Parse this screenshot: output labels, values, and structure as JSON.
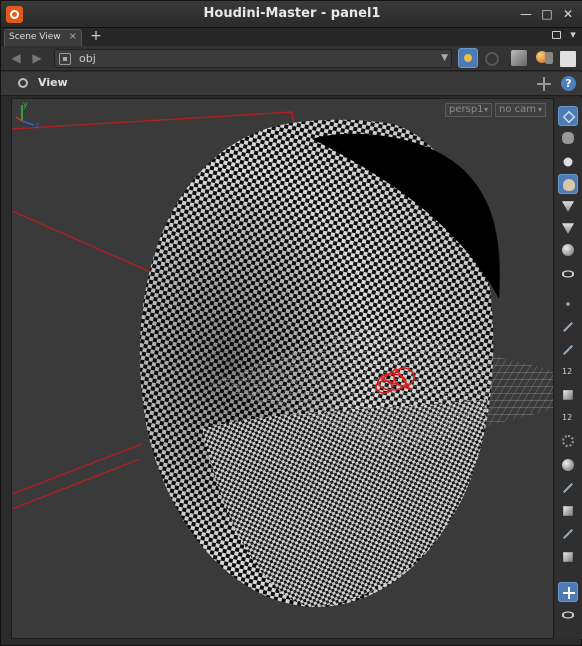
{
  "window": {
    "title": "Houdini-Master - panel1",
    "min_glyph": "—",
    "max_glyph": "□",
    "close_glyph": "✕"
  },
  "tabs": {
    "active_label": "Scene View",
    "close_glyph": "×",
    "add_glyph": "+"
  },
  "pathbar": {
    "back_glyph": "◀",
    "forward_glyph": "▶",
    "path": "obj",
    "dropdown_glyph": "▼"
  },
  "view": {
    "label": "View",
    "help_glyph": "?"
  },
  "viewport": {
    "camera": "persp1",
    "cam_select": "no cam",
    "dropdown_glyph": "▾",
    "axis_labels": {
      "x": "x",
      "y": "y",
      "z": "z"
    },
    "colors": {
      "background": "#3a3a3a",
      "guide_lines": "#b02020",
      "checker_light": "#e6e6e6",
      "checker_dark": "#111111",
      "axis_x": "#d03030",
      "axis_y": "#30c030",
      "axis_z": "#3060e0"
    }
  },
  "right_toolbar": {
    "tools": [
      {
        "name": "select-geometry-tool-icon",
        "active": true
      },
      {
        "name": "handle-tool-icon",
        "active": false
      },
      {
        "name": "sphere-display-icon",
        "active": false
      },
      {
        "name": "user-view-icon",
        "active": true
      },
      {
        "name": "light-icon",
        "active": false
      },
      {
        "name": "light-spot-icon",
        "active": false
      },
      {
        "name": "shading-ball-icon",
        "active": false
      },
      {
        "name": "visibility-eye-icon",
        "active": false
      },
      {
        "name": "point-icon",
        "active": false
      },
      {
        "name": "edge-icon",
        "active": false
      },
      {
        "name": "brush-icon",
        "active": false
      },
      {
        "name": "point-number-icon",
        "active": false
      },
      {
        "name": "primitive-icon",
        "active": false
      },
      {
        "name": "primitive-number-icon",
        "active": false
      },
      {
        "name": "dotted-icon",
        "active": false
      },
      {
        "name": "grid-ball-icon",
        "active": false
      },
      {
        "name": "snap-icon",
        "active": false
      },
      {
        "name": "template-icon",
        "active": false
      },
      {
        "name": "eyedropper-icon",
        "active": false
      },
      {
        "name": "background-image-icon",
        "active": false
      },
      {
        "name": "single-viewport-layout-icon",
        "active": true
      },
      {
        "name": "camera-capture-icon",
        "active": false
      }
    ],
    "labels": {
      "point_number": "12",
      "prim_number": "12"
    }
  }
}
